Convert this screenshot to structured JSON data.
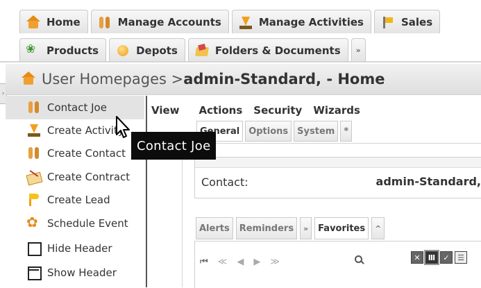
{
  "top_tabs_row1": [
    {
      "label": "Home",
      "icon": "home-icon"
    },
    {
      "label": "Manage Accounts",
      "icon": "accounts-icon"
    },
    {
      "label": "Manage Activities",
      "icon": "activities-icon"
    },
    {
      "label": "Sales",
      "icon": "sales-icon"
    }
  ],
  "top_tabs_row2": [
    {
      "label": "Products",
      "icon": "products-icon"
    },
    {
      "label": "Depots",
      "icon": "depots-icon"
    },
    {
      "label": "Folders & Documents",
      "icon": "folders-icon"
    },
    {
      "label": "»",
      "icon": "more-tabs-icon"
    }
  ],
  "breadcrumb": {
    "prefix": "User Homepages > ",
    "current": "admin-Standard, - Home"
  },
  "sidebar": [
    {
      "label": "Contact Joe",
      "icon": "contact-icon"
    },
    {
      "label": "Create Activity",
      "icon": "create-activity-icon"
    },
    {
      "label": "Create Contact",
      "icon": "create-contact-icon"
    },
    {
      "label": "Create Contract",
      "icon": "create-contract-icon"
    },
    {
      "label": "Create Lead",
      "icon": "create-lead-icon"
    },
    {
      "label": "Schedule Event",
      "icon": "schedule-event-icon"
    },
    {
      "label": "Hide Header",
      "icon": "hide-header-icon"
    },
    {
      "label": "Show Header",
      "icon": "show-header-icon"
    }
  ],
  "menubar": [
    "View",
    "Actions",
    "Security",
    "Wizards"
  ],
  "subtabs": [
    "General",
    "Options",
    "System",
    "*"
  ],
  "contact": {
    "label": "Contact:",
    "value": "admin-Standard,"
  },
  "lower_tabs": [
    "Alerts",
    "Reminders",
    "»",
    "Favorites",
    "^"
  ],
  "pager": [
    "⏮",
    "≪",
    "◀",
    "▶",
    "≫"
  ],
  "tooltip": "Contact Joe"
}
